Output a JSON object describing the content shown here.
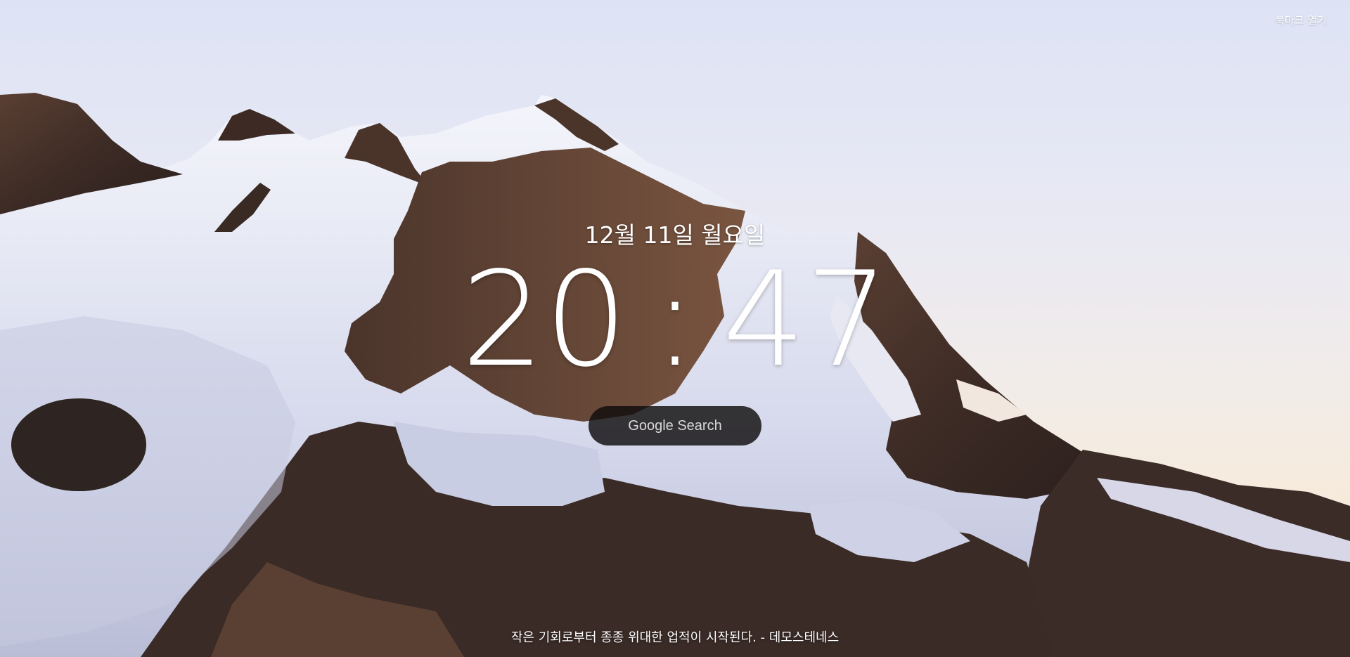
{
  "header": {
    "bookmark_label": "북마크 열기"
  },
  "main": {
    "date": "12월 11일 월요일",
    "time": {
      "hours": "20",
      "separator": ":",
      "minutes": "47"
    },
    "search_button_label": "Google Search"
  },
  "footer": {
    "quote": "작은 기회로부터 종종 위대한 업적이 시작된다. - 데모스테네스"
  },
  "background": {
    "description_icon": "mountain-glacier-photo",
    "colors": {
      "sky_top": "#dde3f5",
      "sky_bottom": "#f4dfc9",
      "snow": "#e8eaf6",
      "rock": "#3a2a24"
    }
  }
}
